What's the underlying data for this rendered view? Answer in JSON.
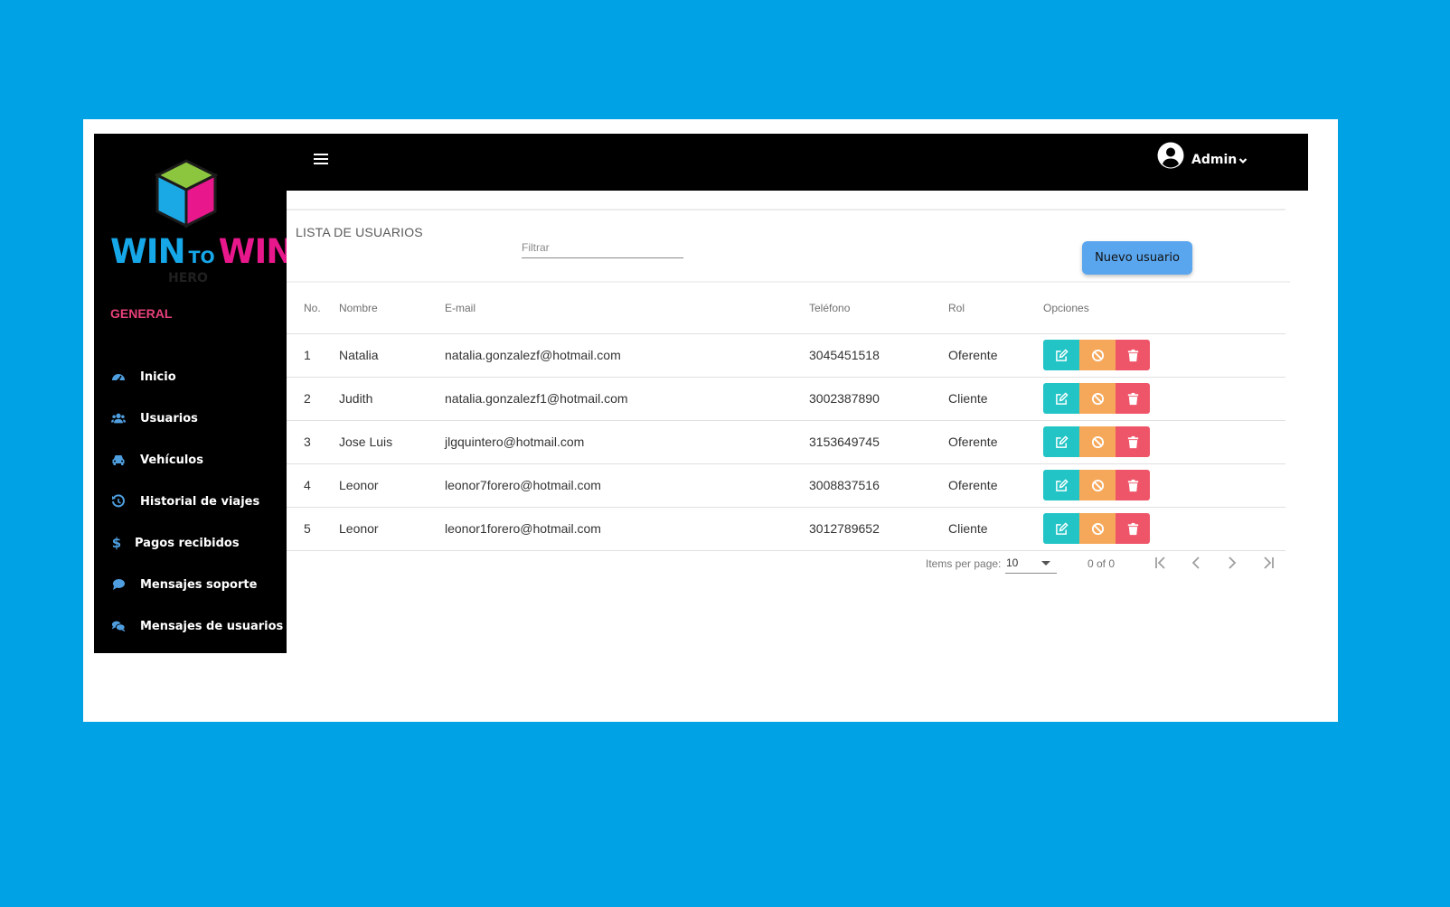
{
  "sidebar": {
    "logo": {
      "word1": "WIN",
      "word2": "TO",
      "word3": "WIN",
      "subtitle": "HERO"
    },
    "section_title": "GENERAL",
    "items": [
      {
        "label": "Inicio",
        "icon": "tachometer-icon"
      },
      {
        "label": "Usuarios",
        "icon": "users-icon"
      },
      {
        "label": "Vehículos",
        "icon": "car-icon"
      },
      {
        "label": "Historial de viajes",
        "icon": "history-icon"
      },
      {
        "label": "Pagos recibidos",
        "icon": "dollar-icon"
      },
      {
        "label": "Mensajes soporte",
        "icon": "comment-icon"
      },
      {
        "label": "Mensajes de usuarios",
        "icon": "comments-icon"
      }
    ]
  },
  "topbar": {
    "menu_icon": "hamburger-icon",
    "user": {
      "name": "Admin",
      "avatar_icon": "user-circle-icon",
      "caret_icon": "chevron-down-icon"
    }
  },
  "main": {
    "title": "LISTA DE USUARIOS",
    "filter": {
      "placeholder": "Filtrar",
      "value": ""
    },
    "new_user_label": "Nuevo usuario",
    "table": {
      "headers": {
        "no": "No.",
        "nombre": "Nombre",
        "email": "E-mail",
        "telefono": "Teléfono",
        "rol": "Rol",
        "opciones": "Opciones"
      },
      "rows": [
        {
          "no": "1",
          "nombre": "Natalia",
          "email": "natalia.gonzalezf@hotmail.com",
          "telefono": "3045451518",
          "rol": "Oferente"
        },
        {
          "no": "2",
          "nombre": "Judith",
          "email": "natalia.gonzalezf1@hotmail.com",
          "telefono": "3002387890",
          "rol": "Cliente"
        },
        {
          "no": "3",
          "nombre": "Jose Luis",
          "email": "jlgquintero@hotmail.com",
          "telefono": "3153649745",
          "rol": "Oferente"
        },
        {
          "no": "4",
          "nombre": "Leonor",
          "email": "leonor7forero@hotmail.com",
          "telefono": "3008837516",
          "rol": "Oferente"
        },
        {
          "no": "5",
          "nombre": "Leonor",
          "email": "leonor1forero@hotmail.com",
          "telefono": "3012789652",
          "rol": "Cliente"
        }
      ],
      "option_icons": [
        "edit-icon",
        "ban-icon",
        "trash-icon"
      ]
    },
    "paginator": {
      "items_per_page_label": "Items per page:",
      "page_size": "10",
      "range_label": "0 of 0"
    }
  },
  "colors": {
    "background": "#00a2e6",
    "sidebar": "#000000",
    "accent_pink": "#e8407a",
    "icon_blue": "#4f9fe0",
    "edit": "#22c4c6",
    "block": "#f6a85a",
    "delete": "#ef5568",
    "primary_button": "#5aa6ee"
  }
}
